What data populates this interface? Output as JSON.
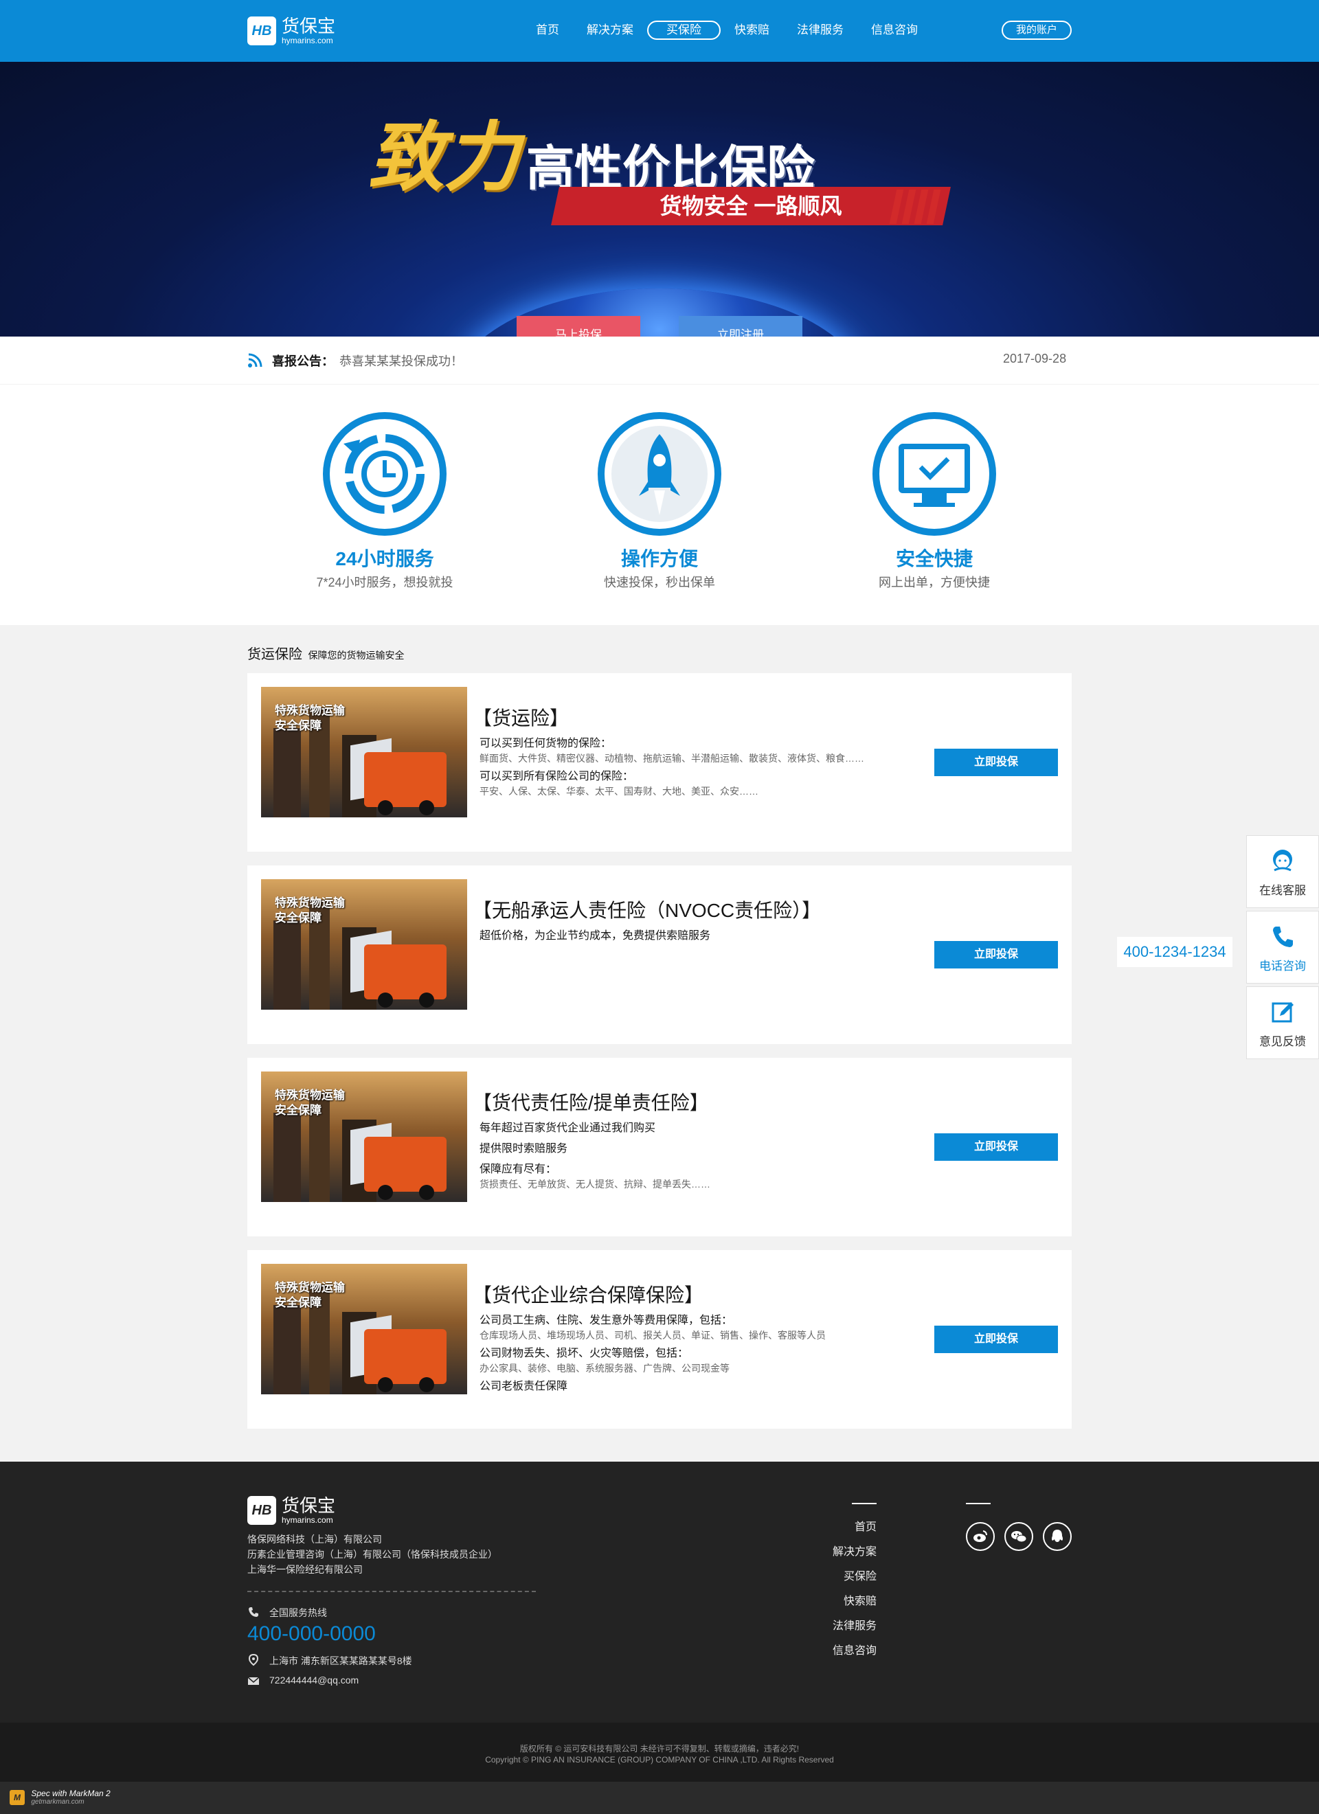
{
  "header": {
    "logo_cn": "货保宝",
    "logo_en": "hymarins.com",
    "nav": [
      {
        "label": "首页"
      },
      {
        "label": "解决方案"
      },
      {
        "label": "买保险",
        "active": true
      },
      {
        "label": "快索赔"
      },
      {
        "label": "法律服务"
      },
      {
        "label": "信息咨询"
      }
    ],
    "account": "我的账户"
  },
  "banner": {
    "title_big": "致力",
    "title_mid": "高性价比保险",
    "subtitle": "货物安全 一路顺风",
    "btn_insure": "马上投保",
    "btn_register": "立即注册"
  },
  "notice": {
    "label": "喜报公告：",
    "text": "恭喜某某某投保成功！",
    "date": "2017-09-28"
  },
  "features": [
    {
      "title": "24小时服务",
      "desc": "7*24小时服务，想投就投",
      "icon": "clock-refresh-icon"
    },
    {
      "title": "操作方便",
      "desc": "快速投保，秒出保单",
      "icon": "rocket-icon"
    },
    {
      "title": "安全快捷",
      "desc": "网上出单，方便快捷",
      "icon": "monitor-check-icon"
    }
  ],
  "section": {
    "title": "货运保险",
    "subtitle": "保障您的货物运输安全"
  },
  "cards": [
    {
      "image_text_1": "特殊货物运输",
      "image_text_2": "安全保障",
      "title": "【货运险】",
      "lines": [
        {
          "main": "可以买到任何货物的保险：",
          "sub": "鲜面货、大件货、精密仪器、动植物、拖航运输、半潜船运输、散装货、液体货、粮食……"
        },
        {
          "main": "可以买到所有保险公司的保险：",
          "sub": "平安、人保、太保、华泰、太平、国寿财、大地、美亚、众安……"
        }
      ],
      "button": "立即投保"
    },
    {
      "image_text_1": "特殊货物运输",
      "image_text_2": "安全保障",
      "title": "【无船承运人责任险（NVOCC责任险）】",
      "lines": [
        {
          "main": "超低价格，为企业节约成本，免费提供索赔服务",
          "sub": ""
        }
      ],
      "button": "立即投保"
    },
    {
      "image_text_1": "特殊货物运输",
      "image_text_2": "安全保障",
      "title": "【货代责任险/提单责任险】",
      "lines": [
        {
          "main": "每年超过百家货代企业通过我们购买",
          "sub": ""
        },
        {
          "main": "提供限时索赔服务",
          "sub": ""
        },
        {
          "main": "保障应有尽有：",
          "sub": "货损责任、无单放货、无人提货、抗辩、提单丢失……"
        }
      ],
      "button": "立即投保"
    },
    {
      "image_text_1": "特殊货物运输",
      "image_text_2": "安全保障",
      "title": "【货代企业综合保障保险】",
      "lines": [
        {
          "main": "公司员工生病、住院、发生意外等费用保障，包括：",
          "sub": "仓库现场人员、堆场现场人员、司机、报关人员、单证、销售、操作、客服等人员"
        },
        {
          "main": "公司财物丢失、损坏、火灾等赔偿，包括：",
          "sub": "办公家具、装修、电脑、系统服务器、广告牌、公司现金等"
        },
        {
          "main": "公司老板责任保障",
          "sub": ""
        }
      ],
      "button": "立即投保"
    }
  ],
  "side": {
    "online": "在线客服",
    "phone": "电话咨询",
    "phone_number": "400-1234-1234",
    "feedback": "意见反馈"
  },
  "footer": {
    "logo_cn": "货保宝",
    "logo_en": "hymarins.com",
    "company_1": "恪保网络科技（上海）有限公司",
    "company_2": "历素企业管理咨询（上海）有限公司（恪保科技成员企业）",
    "company_3": "上海华一保险经纪有限公司",
    "hotline_label": "全国服务热线",
    "hotline": "400-000-0000",
    "address": "上海市  浦东新区某某路某某号8楼",
    "email": "722444444@qq.com",
    "nav": [
      "首页",
      "解决方案",
      "买保险",
      "快索赔",
      "法律服务",
      "信息咨询"
    ],
    "social": [
      "weibo-icon",
      "wechat-icon",
      "qq-icon"
    ],
    "copyright_1": "版权所有 © 运可安科技有限公司 未经许可不得复制、转载或摘编，违者必究!",
    "copyright_2": "Copyright © PING AN INSURANCE (GROUP) COMPANY OF CHINA ,LTD. All Rights Reserved"
  },
  "markman": {
    "line1": "Spec with MarkMan 2",
    "line2": "getmarkman.com"
  },
  "colors": {
    "brand_blue": "#0b8ad6",
    "red_button": "#e95565",
    "footer_bg": "#232323"
  }
}
